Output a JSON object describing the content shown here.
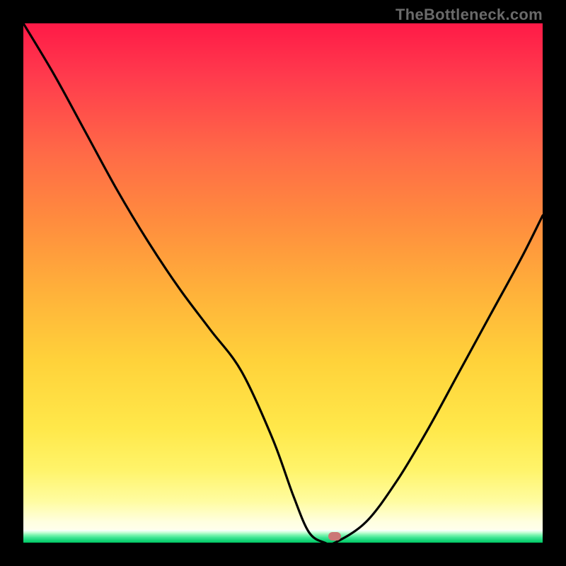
{
  "watermark": "TheBottleneck.com",
  "chart_data": {
    "type": "line",
    "title": "",
    "xlabel": "",
    "ylabel": "",
    "xlim": [
      0,
      100
    ],
    "ylim": [
      0,
      100
    ],
    "series": [
      {
        "name": "bottleneck-curve",
        "x": [
          0,
          6,
          12,
          18,
          24,
          30,
          36,
          42,
          48,
          52,
          55,
          58,
          60,
          66,
          72,
          78,
          84,
          90,
          96,
          100
        ],
        "values": [
          100,
          90,
          79,
          68,
          58,
          49,
          41,
          33,
          20,
          9,
          2,
          0,
          0,
          4,
          12,
          22,
          33,
          44,
          55,
          63
        ]
      }
    ],
    "annotations": [
      {
        "name": "min-marker",
        "x": 60,
        "y": 1.2
      }
    ],
    "background": {
      "type": "vertical-gradient",
      "stops": [
        {
          "pos": 0.0,
          "color": "#ff1a47"
        },
        {
          "pos": 0.5,
          "color": "#ffb23a"
        },
        {
          "pos": 0.8,
          "color": "#ffe84a"
        },
        {
          "pos": 0.95,
          "color": "#ffffe0"
        },
        {
          "pos": 1.0,
          "color": "#00c864"
        }
      ]
    }
  },
  "colors": {
    "curve": "#000000",
    "marker": "#cb7876",
    "frame": "#000000"
  }
}
